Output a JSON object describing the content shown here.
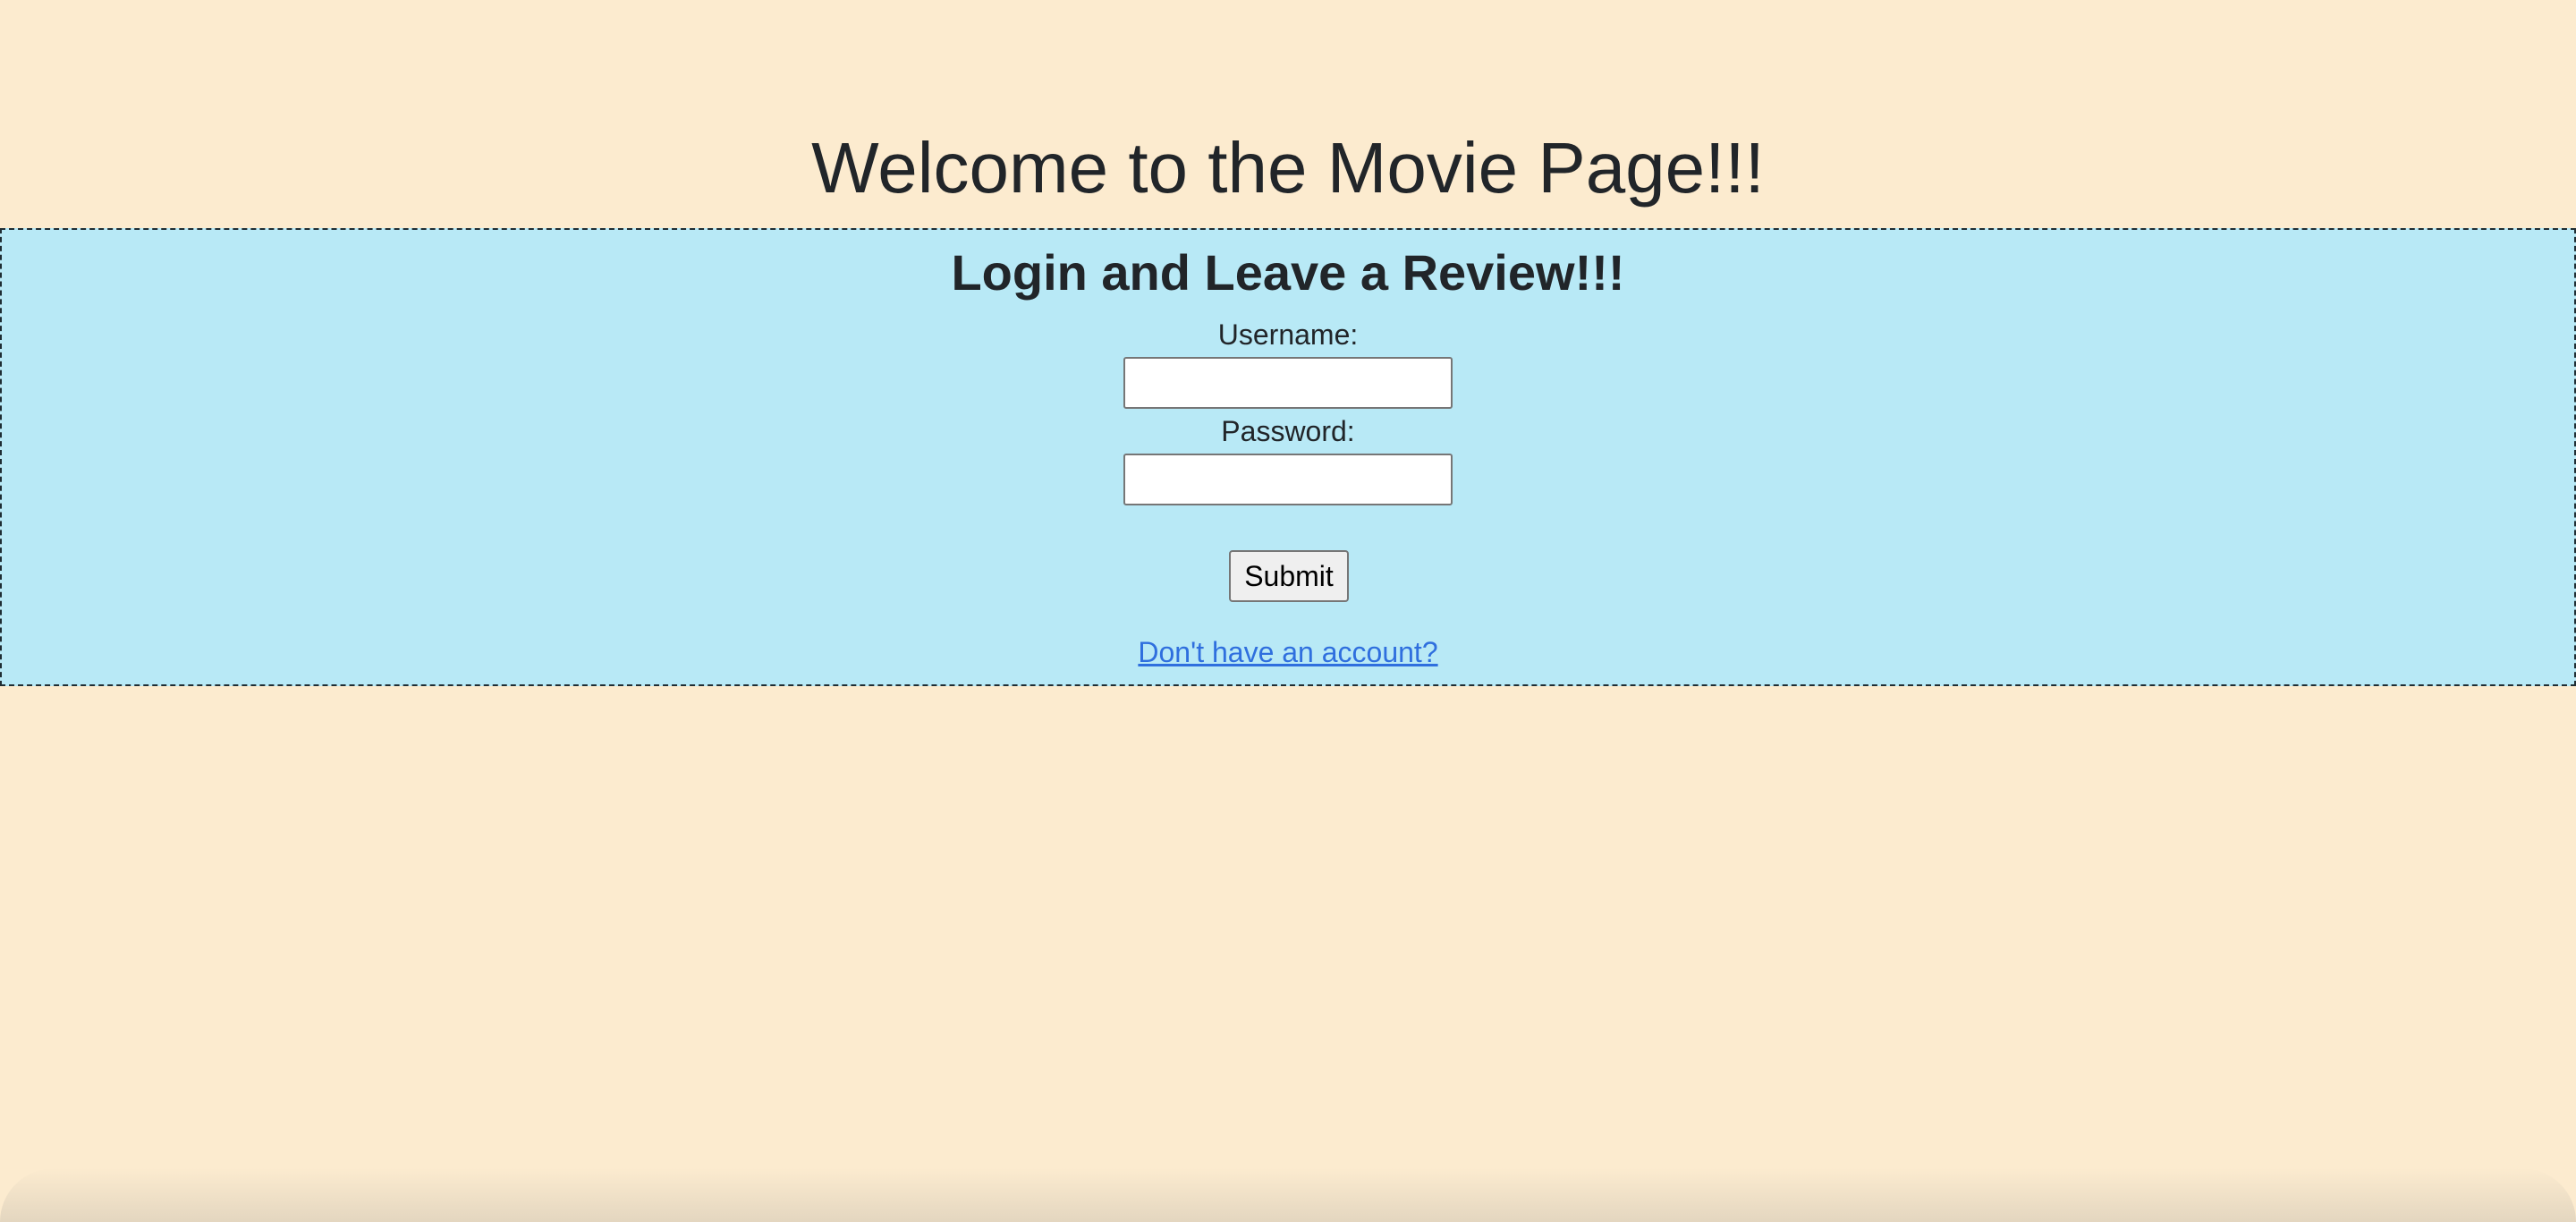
{
  "page": {
    "title": "Welcome to the Movie Page!!!",
    "background_color": "#fcebcf"
  },
  "login": {
    "heading": "Login and Leave a Review!!!",
    "panel_color": "#b8e9f6",
    "username_label": "Username:",
    "username_value": "",
    "password_label": "Password:",
    "password_value": "",
    "submit_label": "Submit",
    "signup_link_text": "Don't have an account?",
    "link_color": "#2f6fde"
  }
}
